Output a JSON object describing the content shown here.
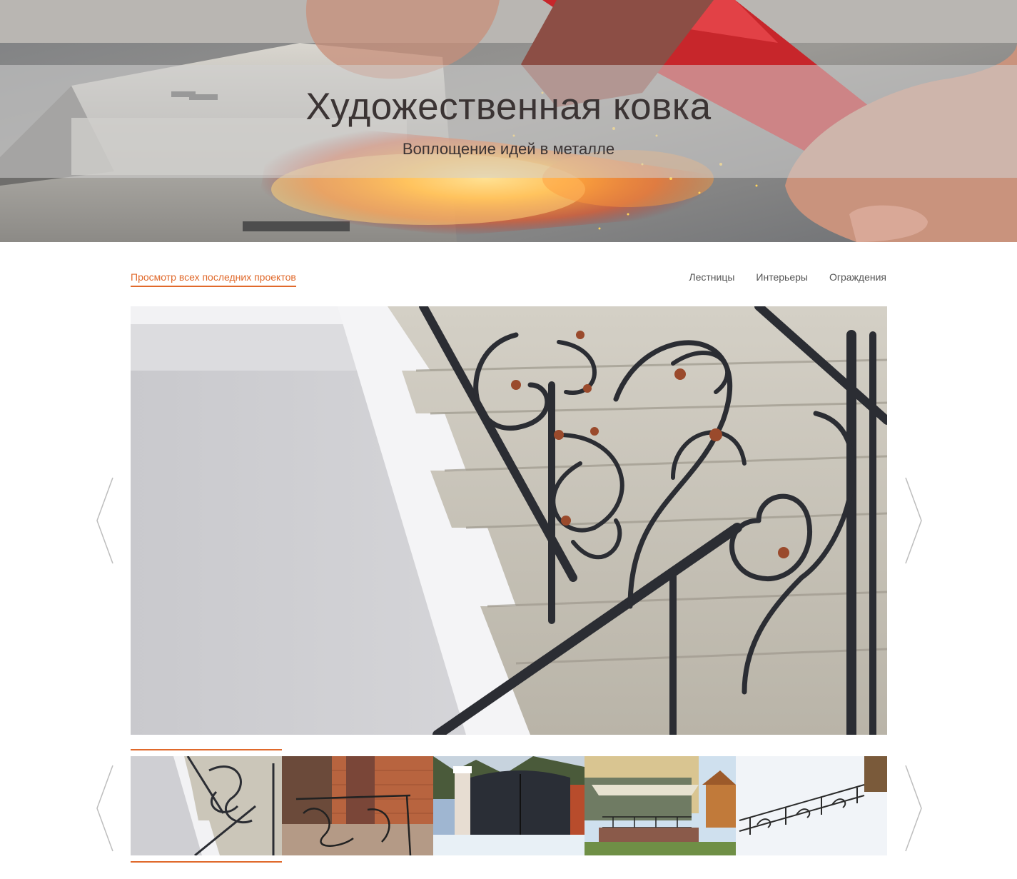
{
  "hero": {
    "title": "Художественная ковка",
    "subtitle": "Воплощение идей в металле"
  },
  "nav": {
    "all_projects": "Просмотр всех последних проектов",
    "categories": [
      {
        "label": "Лестницы"
      },
      {
        "label": "Интерьеры"
      },
      {
        "label": "Ограждения"
      }
    ]
  },
  "gallery": {
    "main_image": "forged-staircase-railing",
    "prev_icon": "chevron-left-icon",
    "next_icon": "chevron-right-icon",
    "thumbnails": [
      {
        "image": "staircase-railing",
        "active": true
      },
      {
        "image": "porch-railing-brick"
      },
      {
        "image": "forged-gate-winter"
      },
      {
        "image": "house-porch-railing"
      },
      {
        "image": "fence-in-snow"
      }
    ]
  },
  "colors": {
    "accent": "#e0692b",
    "title": "#3b3434",
    "nav_text": "#555555"
  }
}
